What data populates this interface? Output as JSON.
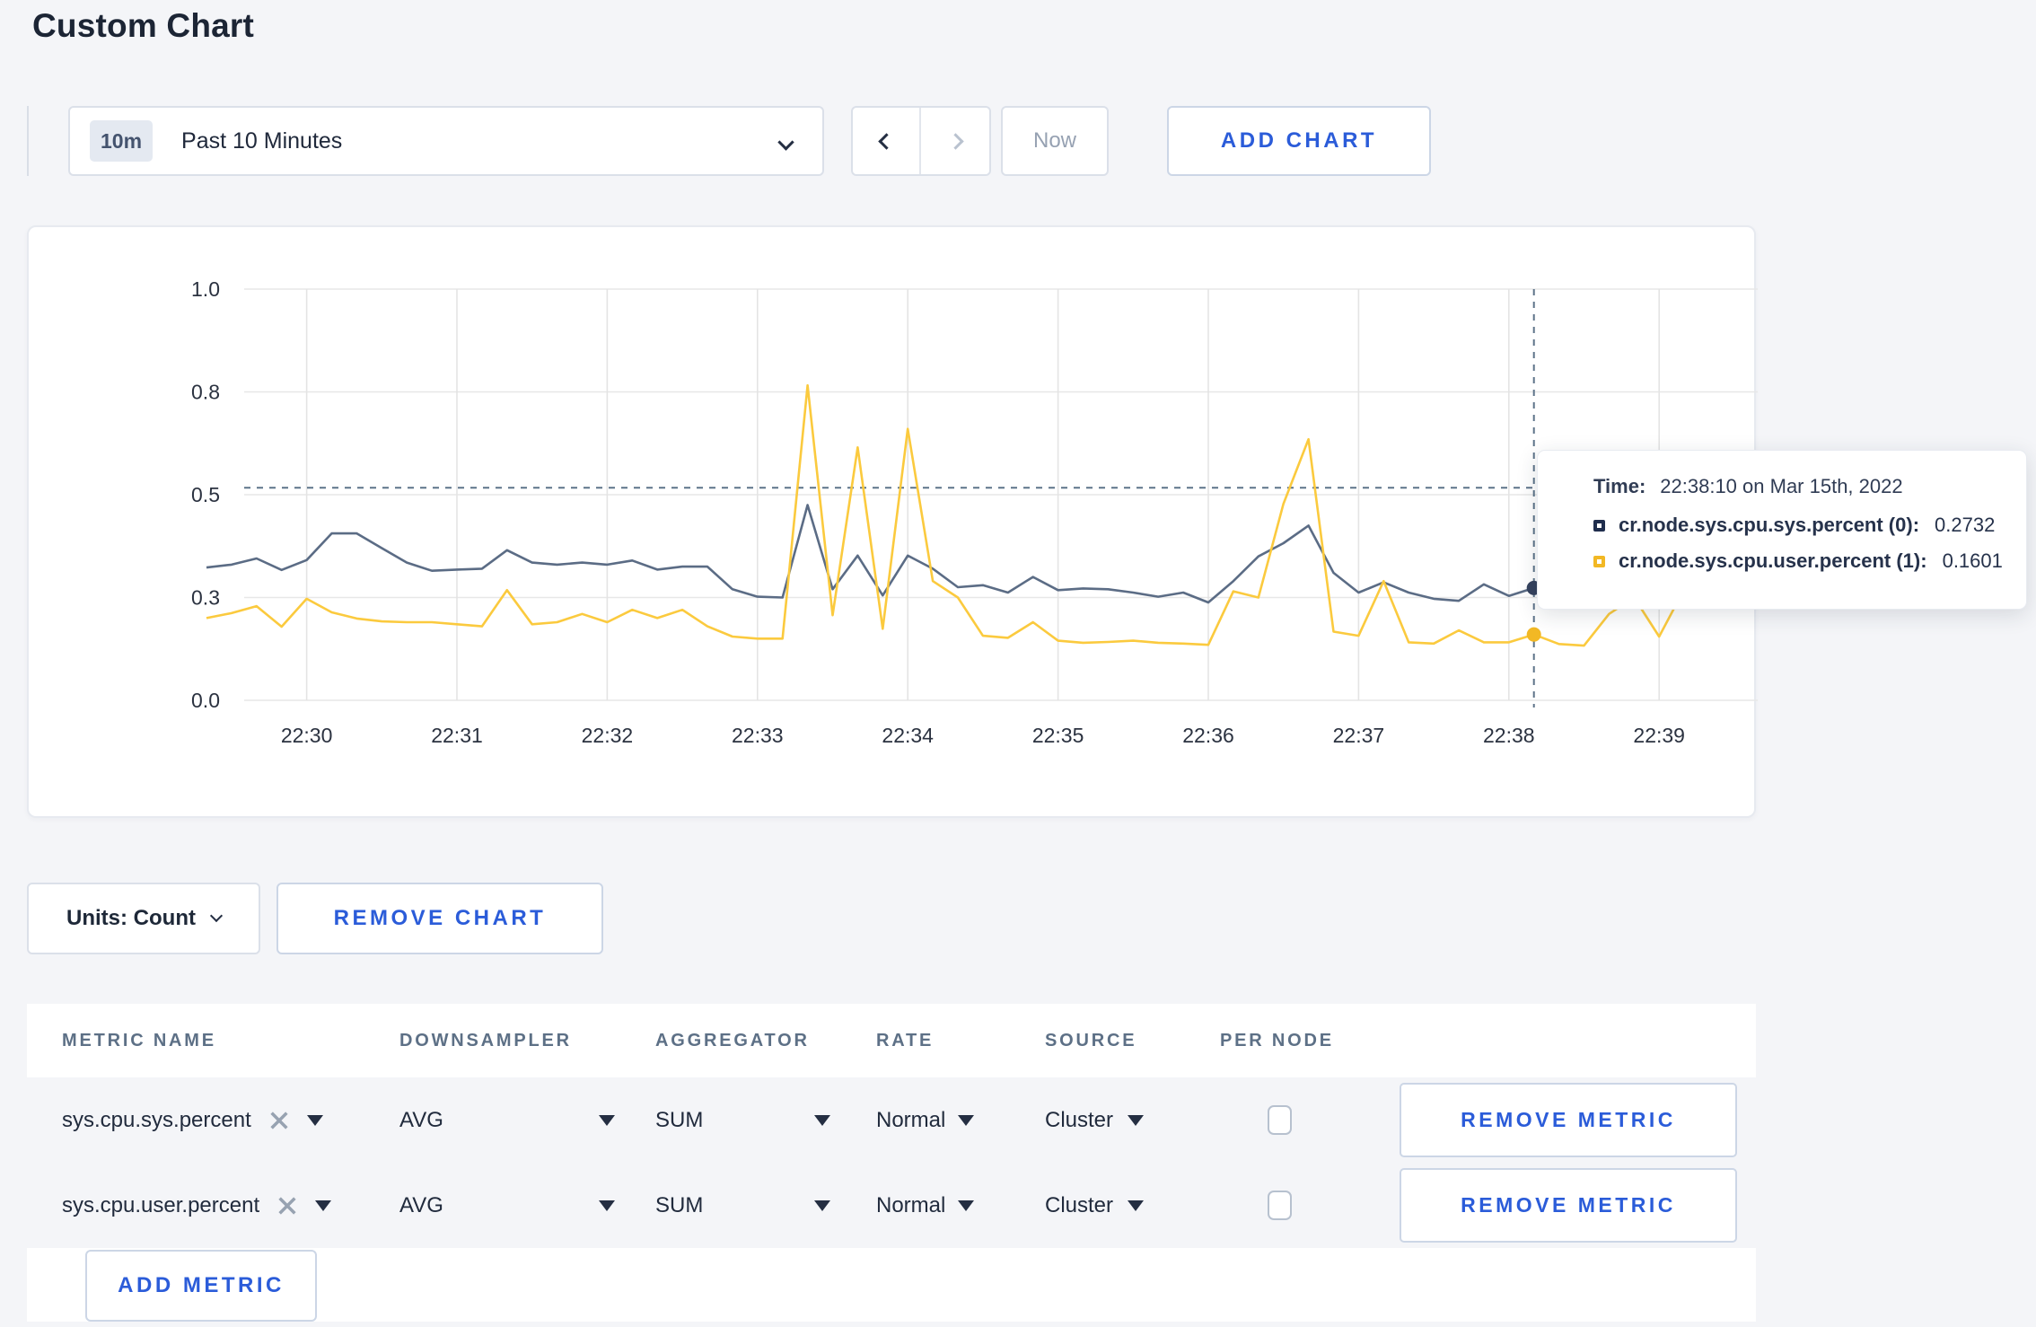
{
  "page": {
    "title": "Custom Chart"
  },
  "toolbar": {
    "range_badge": "10m",
    "range_label": "Past 10 Minutes",
    "now_label": "Now",
    "add_chart_label": "ADD CHART"
  },
  "tooltip": {
    "time_label": "Time:",
    "time_value": "22:38:10 on Mar 15th, 2022",
    "series": [
      {
        "name": "cr.node.sys.cpu.sys.percent (0):",
        "value": "0.2732",
        "color": "#1f2d4d"
      },
      {
        "name": "cr.node.sys.cpu.user.percent (1):",
        "value": "0.1601",
        "color": "#f2b824"
      }
    ]
  },
  "chart_data": {
    "type": "line",
    "title": "",
    "xlabel": "",
    "ylabel": "",
    "x_start": "22:29:20",
    "x_step_seconds": 10,
    "x_tick_labels": [
      "22:30",
      "22:31",
      "22:32",
      "22:33",
      "22:34",
      "22:35",
      "22:36",
      "22:37",
      "22:38",
      "22:39"
    ],
    "ylim": [
      0,
      1
    ],
    "y_tick_values": [
      0,
      0.25,
      0.5,
      0.75,
      1.0
    ],
    "y_tick_labels": [
      "0.0",
      "0.3",
      "0.5",
      "0.8",
      "1.0"
    ],
    "grid": true,
    "legend_position": "tooltip",
    "series": [
      {
        "name": "cr.node.sys.cpu.sys.percent",
        "color": "#5b6c85",
        "marker_color": "#35425e",
        "values": [
          0.323,
          0.33,
          0.345,
          0.317,
          0.341,
          0.406,
          0.406,
          0.37,
          0.335,
          0.315,
          0.318,
          0.32,
          0.365,
          0.335,
          0.33,
          0.335,
          0.33,
          0.34,
          0.318,
          0.325,
          0.325,
          0.27,
          0.252,
          0.25,
          0.475,
          0.27,
          0.352,
          0.255,
          0.352,
          0.32,
          0.275,
          0.28,
          0.262,
          0.3,
          0.268,
          0.272,
          0.27,
          0.262,
          0.252,
          0.262,
          0.238,
          0.29,
          0.35,
          0.382,
          0.425,
          0.31,
          0.262,
          0.287,
          0.262,
          0.247,
          0.242,
          0.282,
          0.254,
          0.2732,
          0.258,
          0.252,
          0.262,
          0.3,
          0.315,
          0.287
        ]
      },
      {
        "name": "cr.node.sys.cpu.user.percent",
        "color": "#fbca3e",
        "marker_color": "#f2b824",
        "values": [
          0.2,
          0.212,
          0.229,
          0.179,
          0.247,
          0.214,
          0.199,
          0.192,
          0.19,
          0.19,
          0.185,
          0.18,
          0.268,
          0.185,
          0.19,
          0.21,
          0.19,
          0.22,
          0.2,
          0.22,
          0.18,
          0.155,
          0.15,
          0.15,
          0.766,
          0.207,
          0.615,
          0.174,
          0.66,
          0.29,
          0.25,
          0.157,
          0.152,
          0.19,
          0.145,
          0.14,
          0.142,
          0.145,
          0.14,
          0.138,
          0.135,
          0.265,
          0.25,
          0.478,
          0.635,
          0.167,
          0.157,
          0.29,
          0.141,
          0.138,
          0.17,
          0.141,
          0.141,
          0.1601,
          0.137,
          0.133,
          0.21,
          0.25,
          0.155,
          0.27
        ]
      }
    ],
    "crosshair": {
      "index": 53,
      "time": "22:38:10",
      "hline_value": 0.517
    }
  },
  "units_row": {
    "units_label": "Units: Count",
    "remove_chart_label": "REMOVE CHART"
  },
  "metrics_table": {
    "headers": {
      "metric": "METRIC NAME",
      "downsampler": "DOWNSAMPLER",
      "aggregator": "AGGREGATOR",
      "rate": "RATE",
      "source": "SOURCE",
      "per_node": "PER NODE"
    },
    "rows": [
      {
        "metric": "sys.cpu.sys.percent",
        "downsampler": "AVG",
        "aggregator": "SUM",
        "rate": "Normal",
        "source": "Cluster",
        "per_node_checked": false,
        "remove_label": "REMOVE METRIC"
      },
      {
        "metric": "sys.cpu.user.percent",
        "downsampler": "AVG",
        "aggregator": "SUM",
        "rate": "Normal",
        "source": "Cluster",
        "per_node_checked": false,
        "remove_label": "REMOVE METRIC"
      }
    ],
    "add_metric_label": "ADD METRIC"
  }
}
